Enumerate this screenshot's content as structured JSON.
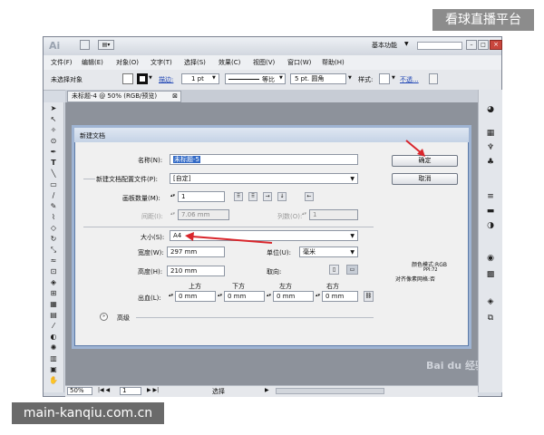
{
  "watermark": {
    "top": "看球直播平台",
    "bottom": "main-kanqiu.com.cn",
    "baidu": "Bai du 经验"
  },
  "app": {
    "logo": "Ai",
    "workspace": "基本功能"
  },
  "menu": [
    "文件(F)",
    "编辑(E)",
    "对象(O)",
    "文字(T)",
    "选择(S)",
    "效果(C)",
    "视图(V)",
    "窗口(W)",
    "帮助(H)"
  ],
  "control_bar": {
    "selection": "未选择对象",
    "stroke_label": "描边:",
    "stroke_value": "1 pt",
    "profile": "等比",
    "brush": "5 pt. 圆角",
    "style_label": "样式:",
    "opacity_label": "不透..."
  },
  "doc_tab": {
    "title": "未标题-4 @ 50% (RGB/预览)"
  },
  "status": {
    "zoom": "50%",
    "page": "1",
    "mode": "选择"
  },
  "dialog": {
    "title": "新建文档",
    "name_label": "名称(N):",
    "name_value": "未标题-5",
    "profile_label": "新建文档配置文件(P):",
    "profile_value": "[自定]",
    "artboards_label": "画板数量(M):",
    "artboards_value": "1",
    "spacing_label": "间距(I):",
    "spacing_value": "7.06 mm",
    "columns_label": "列数(O):",
    "columns_value": "1",
    "size_label": "大小(S):",
    "size_value": "A4",
    "width_label": "宽度(W):",
    "width_value": "297 mm",
    "units_label": "单位(U):",
    "units_value": "毫米",
    "height_label": "高度(H):",
    "height_value": "210 mm",
    "orientation_label": "取向:",
    "bleed_label": "出血(L):",
    "bleed_top": "上方",
    "bleed_bottom": "下方",
    "bleed_left": "左方",
    "bleed_right": "右方",
    "bleed_value": "0 mm",
    "advanced_label": "高级",
    "ok_label": "确定",
    "cancel_label": "取消",
    "color_mode": "颜色模式:RGB",
    "ppi": "PPI:72",
    "align_pixel": "对齐像素网格:否"
  },
  "colors": {
    "accent": "#d9262c",
    "dialog_border": "#5c7aa8",
    "canvas": "#8d929b"
  }
}
